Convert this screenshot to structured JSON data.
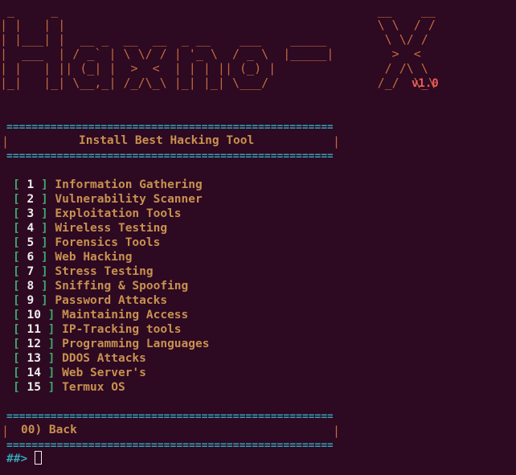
{
  "banner": {
    "ascii_lines": [
      " _     _                                            __    __",
      "| |   | |                                           \\ \\  / /",
      "| |___| |  __ _  __  __  _ __    ___    _____        \\ \\/ /",
      "|  ___  | / _` | \\ \\/ / | '_ \\  / _ \\  |_____|        >  <",
      "| |   | || (_| |  >  <  | | | || (_) |               / /\\ \\",
      "|_|   |_| \\__,_| /_/\\_\\ |_| |_| \\___/               /_/  \\_\\"
    ],
    "version": "v1.0"
  },
  "header": {
    "rule": "================================================================",
    "title": "Install Best Hacking Tool",
    "pipe": "|"
  },
  "menu": {
    "items": [
      {
        "number": "1",
        "label": "Information Gathering"
      },
      {
        "number": "2",
        "label": "Vulnerability Scanner"
      },
      {
        "number": "3",
        "label": "Exploitation Tools"
      },
      {
        "number": "4",
        "label": "Wireless Testing"
      },
      {
        "number": "5",
        "label": "Forensics Tools"
      },
      {
        "number": "6",
        "label": "Web Hacking"
      },
      {
        "number": "7",
        "label": "Stress Testing"
      },
      {
        "number": "8",
        "label": "Sniffing & Spoofing"
      },
      {
        "number": "9",
        "label": "Password Attacks"
      },
      {
        "number": "10",
        "label": "Maintaining Access"
      },
      {
        "number": "11",
        "label": "IP-Tracking tools"
      },
      {
        "number": "12",
        "label": "Programming Languages"
      },
      {
        "number": "13",
        "label": "DDOS Attacks"
      },
      {
        "number": "14",
        "label": "Web Server's"
      },
      {
        "number": "15",
        "label": "Termux OS"
      }
    ],
    "open_bracket": "[",
    "close_bracket": "]"
  },
  "footer": {
    "back_label": "00) Back"
  },
  "prompt": {
    "text": "##>"
  },
  "colors": {
    "background": "#2d0922",
    "banner": "#c46a3b",
    "version": "#ef5a5a",
    "rule": "#33a4b5",
    "bracket": "#3ba96b",
    "label": "#c8914f",
    "number": "#f0ecec"
  }
}
